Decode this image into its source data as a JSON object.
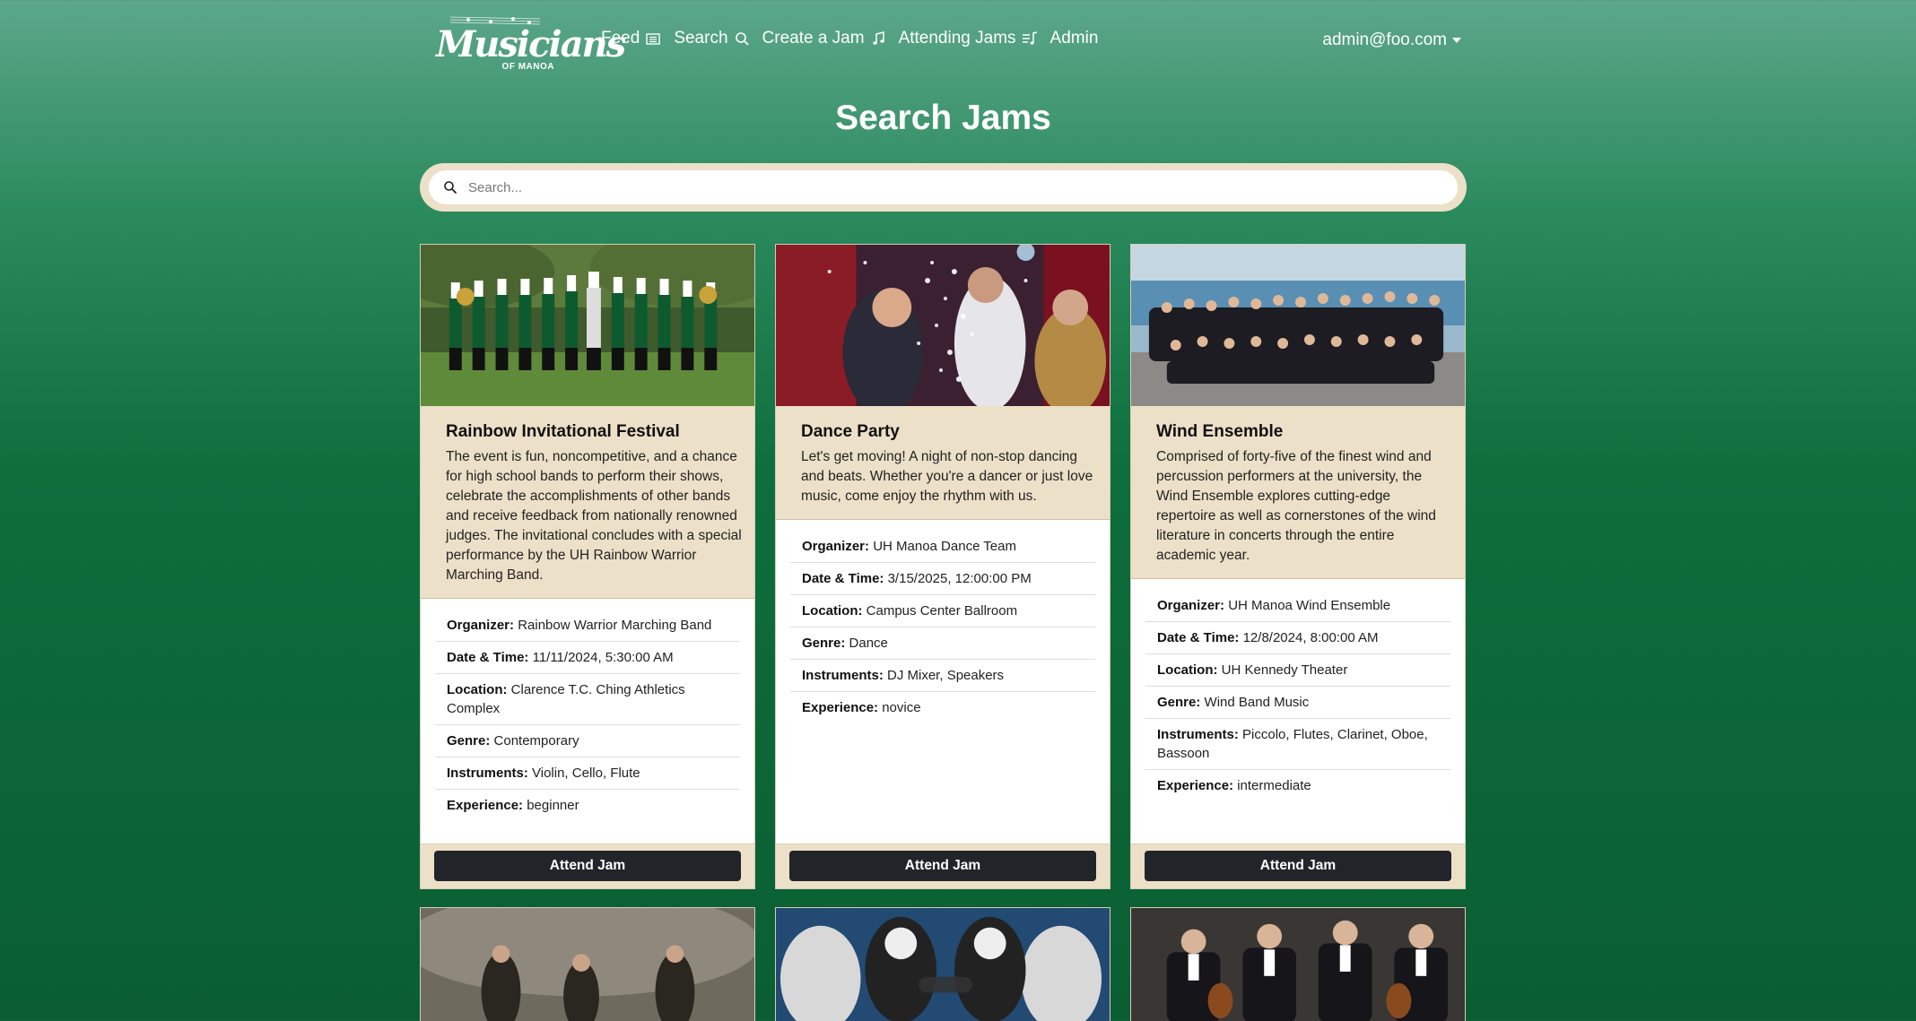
{
  "brand": {
    "logo_text": "Musicians",
    "logo_sub": "OF MANOA"
  },
  "nav": {
    "items": [
      {
        "label": "Feed",
        "icon": "newspaper-icon"
      },
      {
        "label": "Search",
        "icon": "search-icon"
      },
      {
        "label": "Create a Jam",
        "icon": "music-note-icon"
      },
      {
        "label": "Attending Jams",
        "icon": "music-list-icon"
      },
      {
        "label": "Admin",
        "icon": ""
      }
    ],
    "user": "admin@foo.com"
  },
  "page": {
    "title": "Search Jams"
  },
  "search": {
    "placeholder": "Search..."
  },
  "labels": {
    "organizer": "Organizer:",
    "datetime": "Date & Time:",
    "location": "Location:",
    "genre": "Genre:",
    "instruments": "Instruments:",
    "experience": "Experience:",
    "attend": "Attend Jam"
  },
  "jams": [
    {
      "title": "Rainbow Invitational Festival",
      "description": "The event is fun, noncompetitive, and a chance for high school bands to perform their shows, celebrate the accomplishments of other bands and receive feedback from nationally renowned judges. The invitational concludes with a special performance by the UH Rainbow Warrior Marching Band.",
      "organizer": "Rainbow Warrior Marching Band",
      "datetime": "11/11/2024, 5:30:00 AM",
      "location": "Clarence T.C. Ching Athletics Complex",
      "genre": "Contemporary",
      "instruments": "Violin, Cello, Flute",
      "experience": "beginner"
    },
    {
      "title": "Dance Party",
      "description": "Let's get moving! A night of non-stop dancing and beats. Whether you're a dancer or just love music, come enjoy the rhythm with us.",
      "organizer": "UH Manoa Dance Team",
      "datetime": "3/15/2025, 12:00:00 PM",
      "location": "Campus Center Ballroom",
      "genre": "Dance",
      "instruments": "DJ Mixer, Speakers",
      "experience": "novice"
    },
    {
      "title": "Wind Ensemble",
      "description": "Comprised of forty-five of the finest wind and percussion performers at the university, the Wind Ensemble explores cutting-edge repertoire as well as cornerstones of the wind literature in concerts through the entire academic year.",
      "organizer": "UH Manoa Wind Ensemble",
      "datetime": "12/8/2024, 8:00:00 AM",
      "location": "UH Kennedy Theater",
      "genre": "Wind Band Music",
      "instruments": "Piccolo, Flutes, Clarinet, Oboe, Bassoon",
      "experience": "intermediate"
    }
  ]
}
